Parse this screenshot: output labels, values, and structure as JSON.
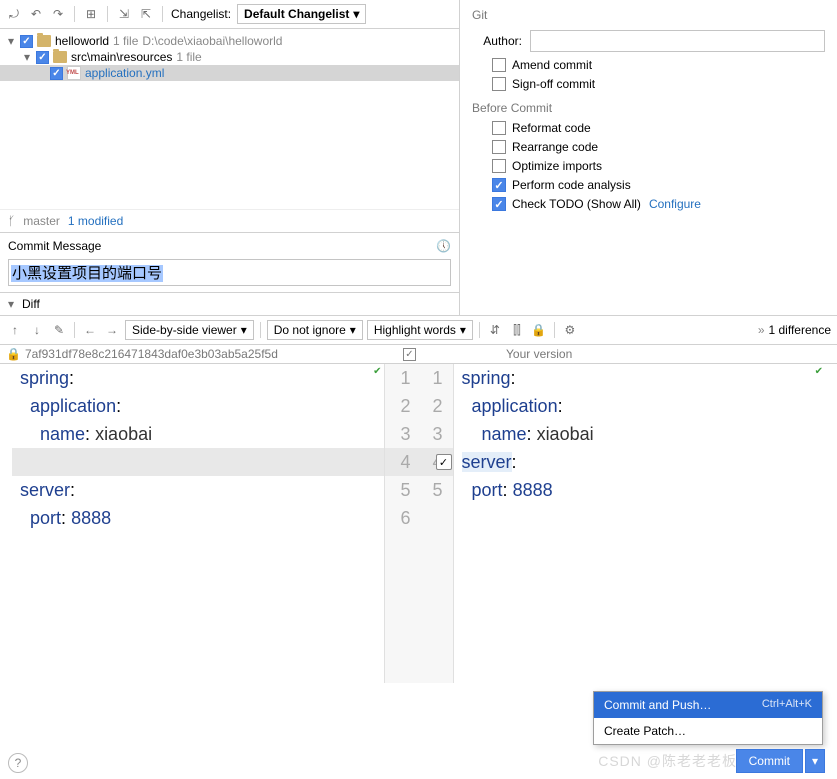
{
  "toolbar": {
    "changelist_label": "Changelist:",
    "changelist_value": "Default Changelist"
  },
  "tree": {
    "root": {
      "name": "helloworld",
      "meta": "1 file",
      "path": "D:\\code\\xiaobai\\helloworld"
    },
    "child1": {
      "name": "src\\main\\resources",
      "meta": "1 file"
    },
    "file": {
      "name": "application.yml"
    }
  },
  "branch": {
    "name": "master",
    "modified": "1 modified"
  },
  "commit_message_label": "Commit Message",
  "commit_message_value": "小黑设置项目的端口号",
  "diff_label": "Diff",
  "git_label": "Git",
  "author_label": "Author:",
  "author_value": "",
  "checks": {
    "amend": "Amend commit",
    "signoff": "Sign-off commit",
    "reformat": "Reformat code",
    "rearrange": "Rearrange code",
    "optimize": "Optimize imports",
    "analysis": "Perform code analysis",
    "todo": "Check TODO (Show All)",
    "configure": "Configure"
  },
  "before_commit_label": "Before Commit",
  "diff_toolbar": {
    "viewer": "Side-by-side viewer",
    "ignore": "Do not ignore",
    "highlight": "Highlight words",
    "diffcount": "1 difference"
  },
  "diff_info": {
    "hash": "7af931df78e8c216471843daf0e3b03ab5a25f5d",
    "your_version": "Your version"
  },
  "old_code": [
    "spring:",
    "  application:",
    "    name: xiaobai",
    "",
    "server:",
    "  port: 8888"
  ],
  "new_code": [
    "spring:",
    "  application:",
    "    name: xiaobai",
    "server:",
    "  port: 8888"
  ],
  "menu": {
    "commit_push": "Commit and Push…",
    "commit_push_sc": "Ctrl+Alt+K",
    "create_patch": "Create Patch…"
  },
  "commit_btn": "Commit",
  "watermark": "CSDN @陈老老老板"
}
